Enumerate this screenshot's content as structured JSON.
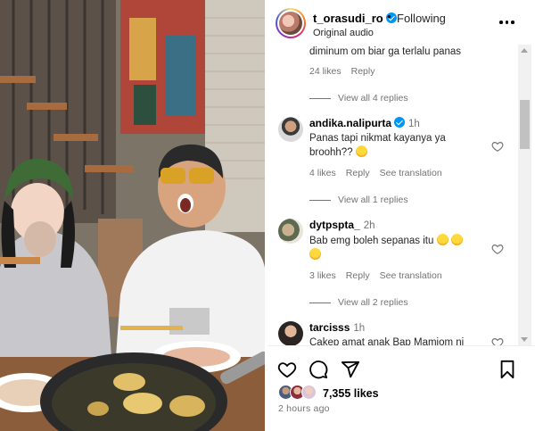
{
  "post": {
    "username": "t_orasudi_ro",
    "separator": "•",
    "follow_label": "Following",
    "audio_label": "Original audio",
    "more_icon": "more-horizontal-icon"
  },
  "comments": [
    {
      "text": "diminum om biar ga terlalu panas",
      "likes": "24 likes",
      "reply": "Reply",
      "view_replies": "View all 4 replies"
    },
    {
      "username": "andika.nalipurta",
      "verified": true,
      "time": "1h",
      "text": "Panas tapi nikmat kayanya ya broohh??",
      "emoji": "grinning-sweat-emoji",
      "likes": "4 likes",
      "reply": "Reply",
      "translation": "See translation",
      "view_replies": "View all 1 replies"
    },
    {
      "username": "dytpspta_",
      "time": "2h",
      "text_line1": "Bab emg boleh sepanas itu",
      "emojis": [
        "loudly-crying-emoji",
        "rolling-laughing-emoji",
        "rolling-laughing-emoji"
      ],
      "likes": "3 likes",
      "reply": "Reply",
      "translation": "See translation",
      "view_replies": "View all 2 replies"
    },
    {
      "username": "tarcisss",
      "time": "1h",
      "text": "Cakep amat anak Bap Mamiom ni"
    }
  ],
  "footer": {
    "likes": "7,355 likes",
    "time_ago": "2 hours ago"
  },
  "colors": {
    "accent_blue": "#0095f6",
    "muted_text": "#737373",
    "primary_text": "#000000"
  }
}
